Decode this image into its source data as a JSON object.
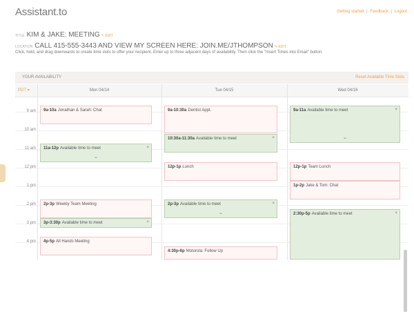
{
  "brand": "Assistant.to",
  "top_links": [
    "Getting started",
    "Feedback",
    "Logout"
  ],
  "title_field": {
    "label": "TITLE",
    "value": "KIM & JAKE: MEETING",
    "edit": "EDIT"
  },
  "location_field": {
    "label": "LOCATION",
    "value": "CALL 415-555-3443 AND VIEW MY SCREEN HERE: JOIN.ME/JTHOMPSON",
    "edit": "EDIT"
  },
  "instructions": "Click, hold, and drag downwards to create time slots to offer your recipient. Enter up to three adjacent days of availability. Then click the \"Insert Times into Email\" button.",
  "availability": {
    "title": "YOUR AVAILABILITY",
    "action": "Reset Available Time Slots"
  },
  "calendar": {
    "timezone": "PDT",
    "days": [
      "Mon 04/14",
      "Tue 04/15",
      "Wed 04/16"
    ],
    "hours": [
      "9 am",
      "10 am",
      "11 am",
      "12 pm",
      "1 pm",
      "2 pm",
      "3 pm",
      "4 pm"
    ],
    "events": {
      "mon_1": {
        "time": "9a-10a",
        "title": "Jonathan & Sarah: Chat"
      },
      "mon_2": {
        "time": "11a-12p",
        "title": "Available time to meet"
      },
      "mon_3": {
        "time": "2p-3p",
        "title": "Weekly Team Meeting"
      },
      "mon_4": {
        "time": "3p-3:30p",
        "title": "Available time to meet"
      },
      "mon_5": {
        "time": "4p-5p",
        "title": "All Hands Meeting"
      },
      "tue_1": {
        "time": "9a-10:30a",
        "title": "Dentist Appt."
      },
      "tue_2": {
        "time": "10:30a-11:30a",
        "title": "Available time to meet"
      },
      "tue_3": {
        "time": "12p-1p",
        "title": "Lunch"
      },
      "tue_4": {
        "time": "2p-3p",
        "title": "Available time to meet"
      },
      "tue_5": {
        "time": "4:30p-6p",
        "title": "Motorola: Follow Up"
      },
      "wed_1": {
        "time": "9a-11a",
        "title": "Available time to meet"
      },
      "wed_2": {
        "time": "12p-1p",
        "title": "Team Lunch"
      },
      "wed_3": {
        "time": "1p-2p",
        "title": "Jake & Tom: Chat"
      },
      "wed_4": {
        "time": "2:30p-5p",
        "title": "Available time to meet"
      }
    }
  }
}
